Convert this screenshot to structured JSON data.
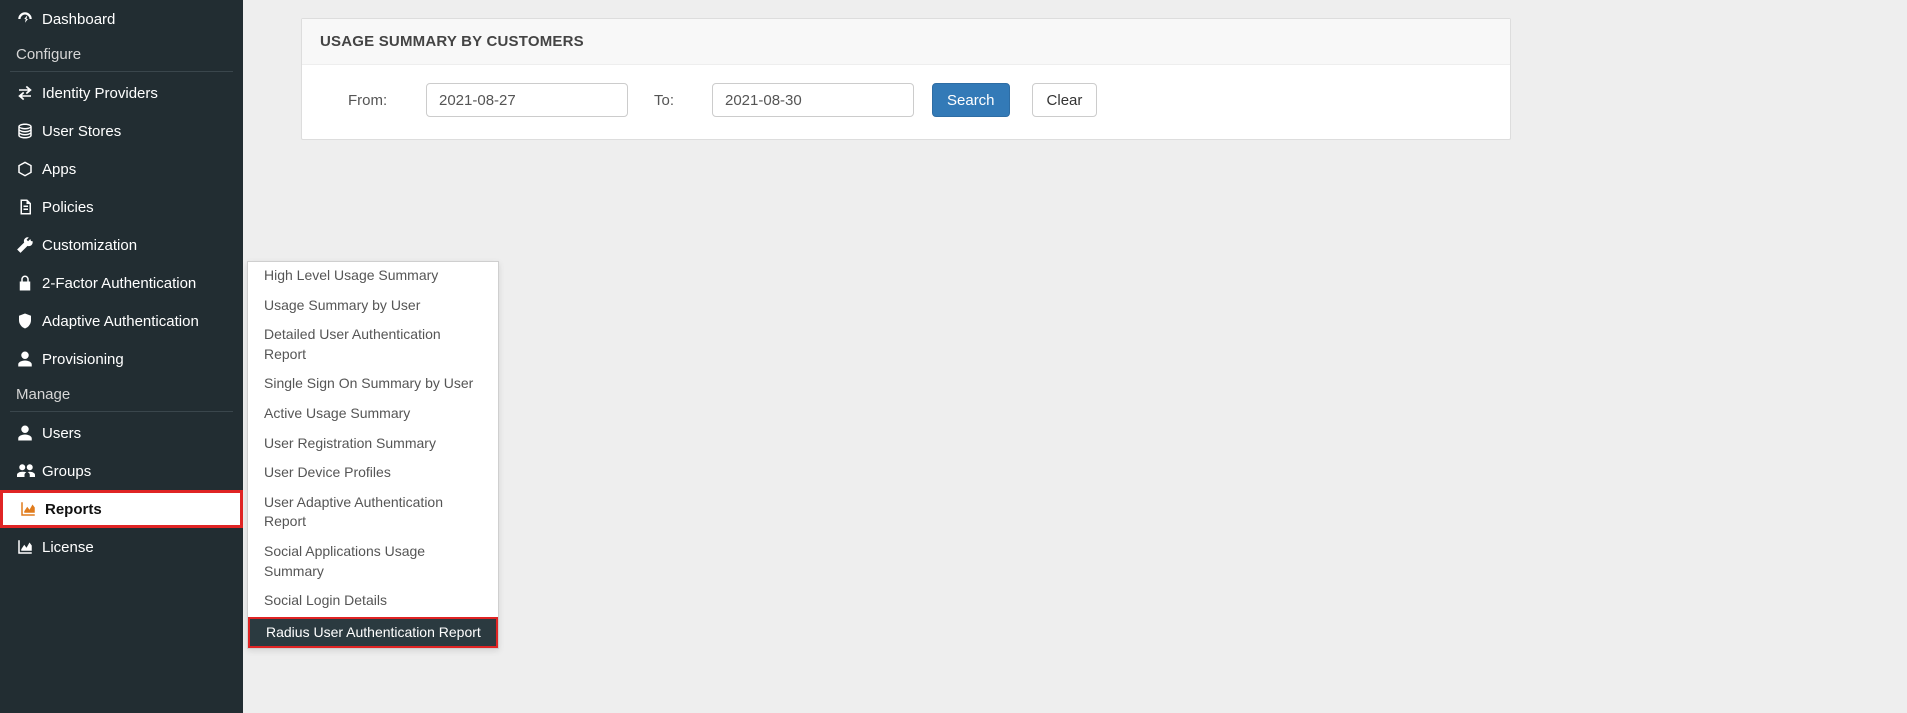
{
  "sidebar": {
    "items": [
      {
        "label": "Dashboard",
        "icon": "dashboard-icon"
      }
    ],
    "section_configure": "Configure",
    "configure_items": [
      {
        "label": "Identity Providers",
        "icon": "exchange-icon"
      },
      {
        "label": "User Stores",
        "icon": "database-icon"
      },
      {
        "label": "Apps",
        "icon": "cube-icon"
      },
      {
        "label": "Policies",
        "icon": "document-icon"
      },
      {
        "label": "Customization",
        "icon": "wrench-icon"
      },
      {
        "label": "2-Factor Authentication",
        "icon": "lock-icon"
      },
      {
        "label": "Adaptive Authentication",
        "icon": "shield-icon"
      },
      {
        "label": "Provisioning",
        "icon": "user-icon"
      }
    ],
    "section_manage": "Manage",
    "manage_items": [
      {
        "label": "Users",
        "icon": "user-icon"
      },
      {
        "label": "Groups",
        "icon": "users-icon"
      },
      {
        "label": "Reports",
        "icon": "area-chart-icon",
        "active": true
      },
      {
        "label": "License",
        "icon": "area-chart-icon"
      }
    ]
  },
  "flyout": {
    "items": [
      "High Level Usage Summary",
      "Usage Summary by User",
      "Detailed User Authentication Report",
      "Single Sign On Summary by User",
      "Active Usage Summary",
      "User Registration Summary",
      "User Device Profiles",
      "User Adaptive Authentication Report",
      "Social Applications Usage Summary",
      "Social Login Details",
      "Radius User Authentication Report"
    ],
    "active_index": 10
  },
  "panel": {
    "title": "USAGE SUMMARY BY CUSTOMERS",
    "from_label": "From:",
    "to_label": "To:",
    "from_value": "2021-08-27",
    "to_value": "2021-08-30",
    "search_label": "Search",
    "clear_label": "Clear"
  }
}
